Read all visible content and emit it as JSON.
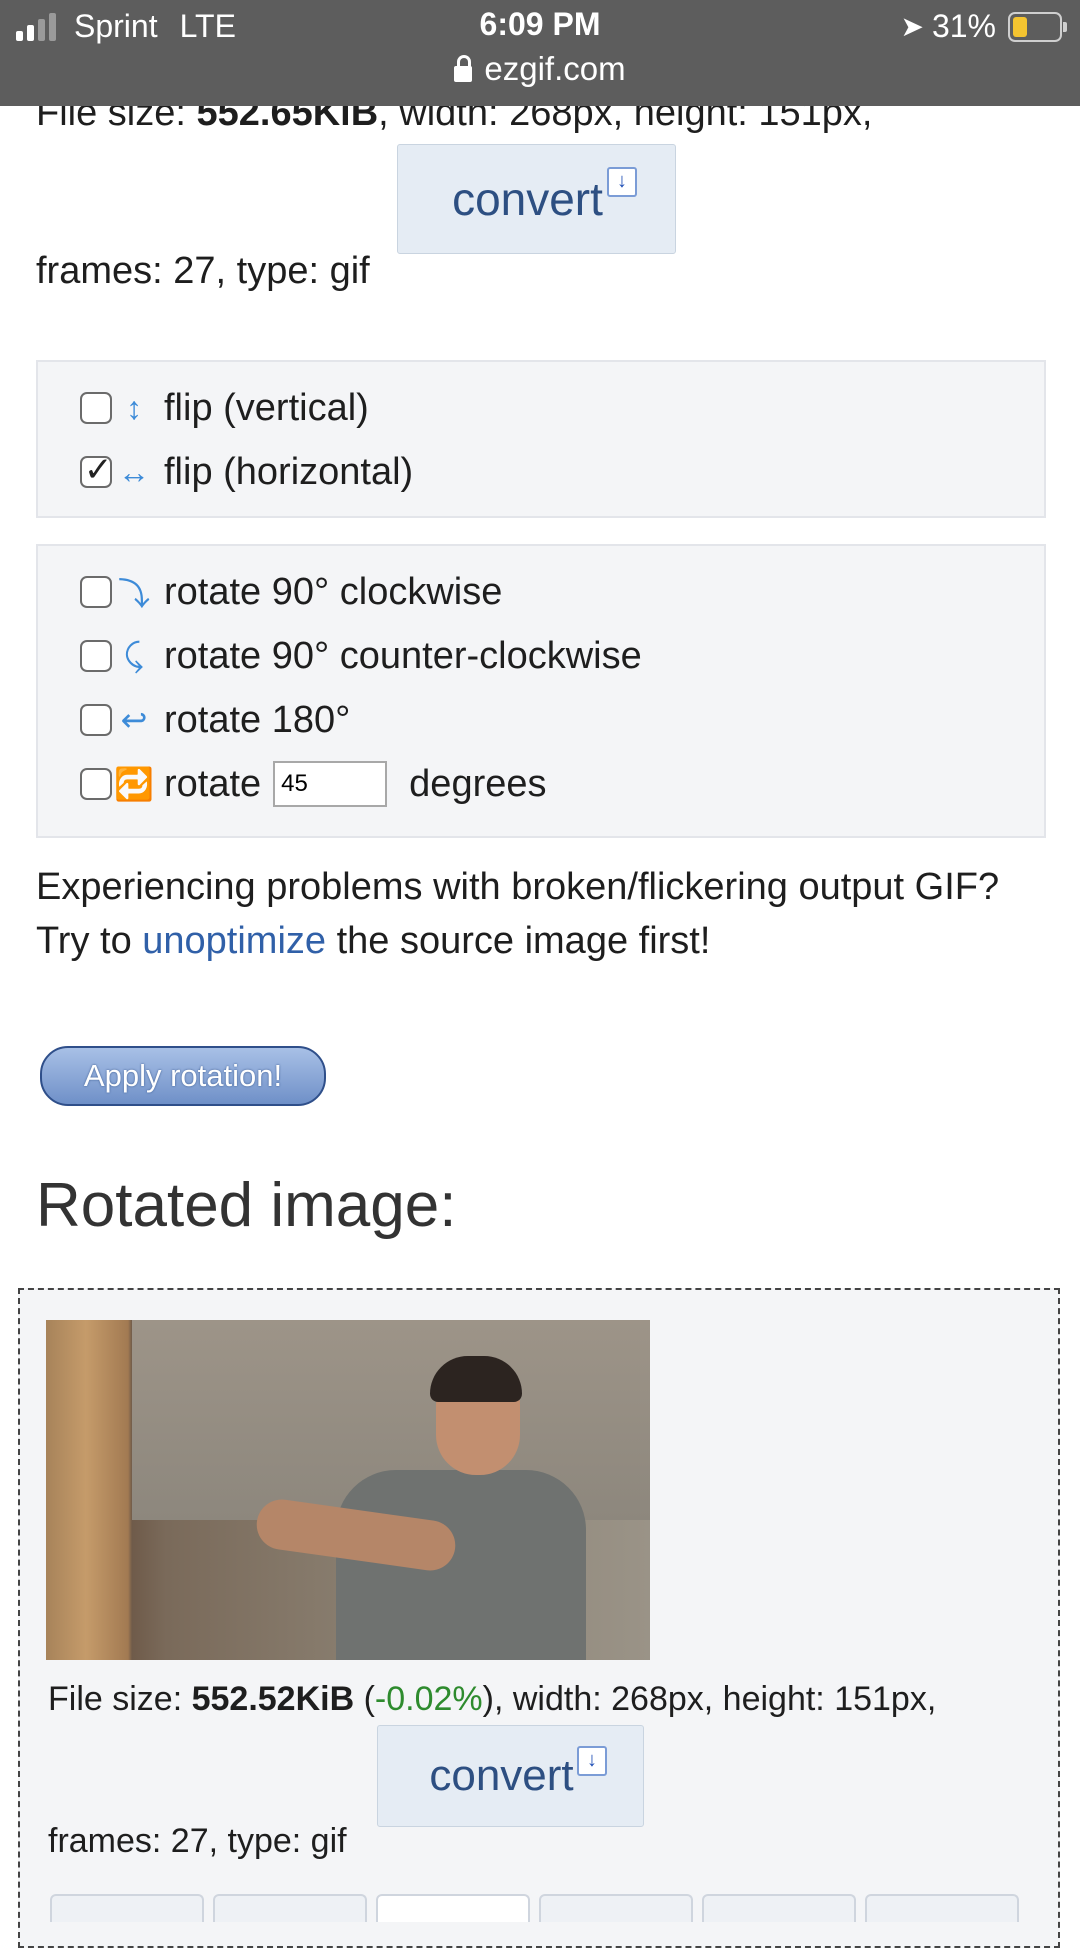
{
  "status_bar": {
    "carrier": "Sprint",
    "network": "LTE",
    "time": "6:09 PM",
    "url": "ezgif.com",
    "battery_text": "31%",
    "battery_level": 0.31
  },
  "source_info": {
    "file_size_label": "File size: ",
    "file_size": "552.65KiB",
    "dims_text": ", width: 268px, height: 151px,",
    "frames_text": "frames: 27, type: gif",
    "convert_label": "convert"
  },
  "flip_options": [
    {
      "label": "flip (vertical)",
      "checked": false,
      "icon": "vertical-arrows-icon"
    },
    {
      "label": "flip (horizontal)",
      "checked": true,
      "icon": "horizontal-arrows-icon"
    }
  ],
  "rotate_options": [
    {
      "label": "rotate 90° clockwise",
      "checked": false,
      "icon": "rotate-clockwise-icon"
    },
    {
      "label": "rotate 90° counter-clockwise",
      "checked": false,
      "icon": "rotate-counterclockwise-icon"
    },
    {
      "label": "rotate 180°",
      "checked": false,
      "icon": "rotate-180-icon"
    },
    {
      "label_pre": "rotate",
      "value": "45",
      "label_post": "degrees",
      "checked": false,
      "icon": "rotate-custom-icon"
    }
  ],
  "notice": {
    "line1": "Experiencing problems with broken/flickering output GIF?",
    "line2_pre": "Try to ",
    "link": "unoptimize",
    "line2_post": " the source image first!"
  },
  "apply_button": "Apply rotation!",
  "result": {
    "heading": "Rotated image:",
    "file_size_label": "File size: ",
    "file_size": "552.52KiB",
    "paren_open": " (",
    "delta": "-0.02%",
    "dims_text": "), width: 268px, height: 151px,",
    "frames_text": "frames: 27, type: gif",
    "convert_label": "convert",
    "colors": {
      "delta": "#2e8b2e"
    }
  }
}
